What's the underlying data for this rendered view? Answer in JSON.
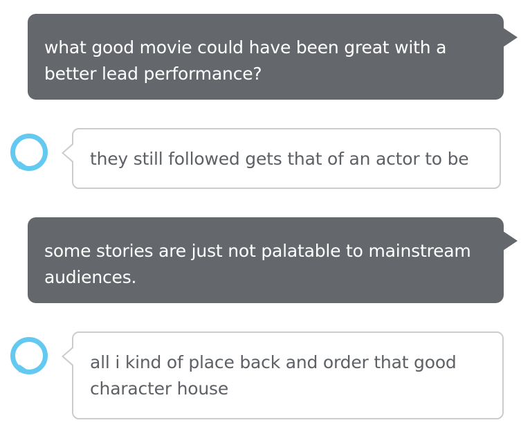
{
  "conversation": {
    "messages": [
      {
        "role": "user",
        "text": "what good movie could have been great with a better lead performance?"
      },
      {
        "role": "assistant",
        "icon": "alexa-ring-icon",
        "text": "they still followed gets that of an actor to be"
      },
      {
        "role": "user",
        "text": "some stories are just not palatable to mainstream audiences."
      },
      {
        "role": "assistant",
        "icon": "alexa-ring-icon",
        "text": "all i kind of place back and order that good character house"
      }
    ]
  },
  "colors": {
    "user_bubble": "#64676b",
    "user_text": "#ffffff",
    "assistant_border": "#c9cdd0",
    "assistant_text": "#5d6166",
    "alexa_ring": "#63c9f0"
  }
}
